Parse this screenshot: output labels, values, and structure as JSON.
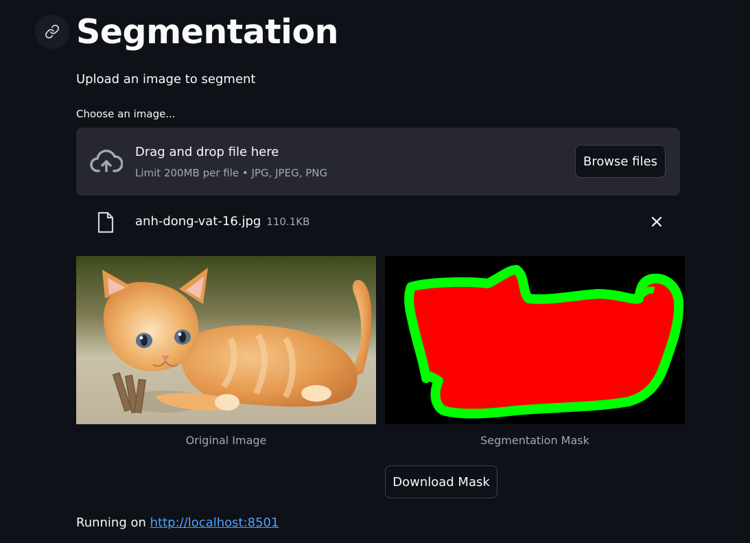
{
  "header": {
    "title": "Segmentation",
    "subtitle": "Upload an image to segment"
  },
  "uploader": {
    "label": "Choose an image...",
    "dropzone_title": "Drag and drop file here",
    "dropzone_limit": "Limit 200MB per file • JPG, JPEG, PNG",
    "browse_label": "Browse files"
  },
  "file": {
    "name": "anh-dong-vat-16.jpg",
    "size": "110.1KB"
  },
  "images": {
    "original_caption": "Original Image",
    "mask_caption": "Segmentation Mask"
  },
  "actions": {
    "download_label": "Download Mask"
  },
  "footer": {
    "running_prefix": "Running on",
    "url": "http://localhost:8501"
  },
  "icons": {
    "anchor": "link-icon",
    "upload": "cloud-upload-icon",
    "file": "file-icon",
    "remove": "close-icon"
  },
  "colors": {
    "background": "#0e1117",
    "dropzone": "#262730",
    "text": "#fafafa",
    "muted": "#a3a8b8",
    "link": "#4da3ff",
    "mask_fill": "#ff0000",
    "mask_outline": "#00ff00"
  }
}
